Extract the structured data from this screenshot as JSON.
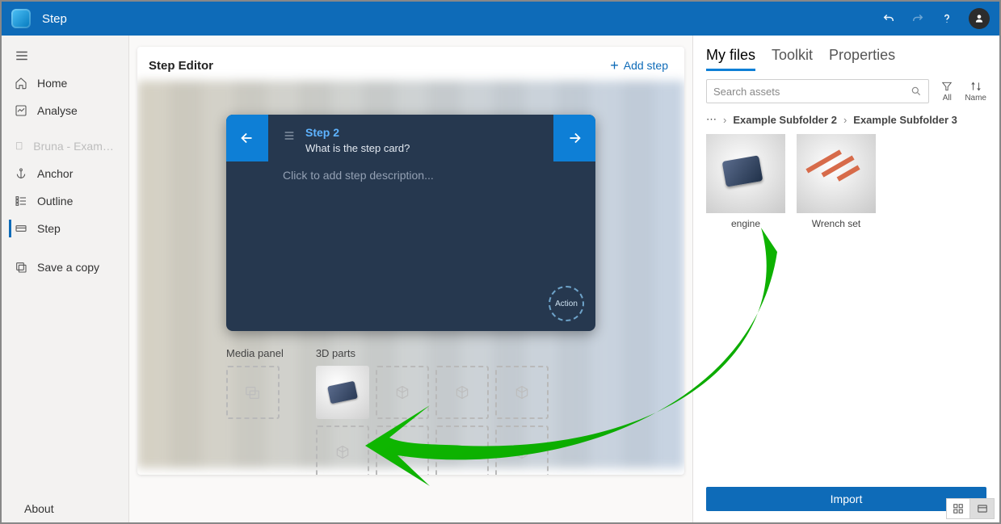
{
  "titlebar": {
    "title": "Step"
  },
  "sidebar": {
    "items": [
      {
        "icon": "home-icon",
        "label": "Home"
      },
      {
        "icon": "analyse-icon",
        "label": "Analyse"
      },
      {
        "icon": "document-icon",
        "label": "Bruna - Example Gui…",
        "dimmed": true
      },
      {
        "icon": "anchor-icon",
        "label": "Anchor"
      },
      {
        "icon": "outline-icon",
        "label": "Outline"
      },
      {
        "icon": "step-icon",
        "label": "Step",
        "active": true
      },
      {
        "icon": "savecopy-icon",
        "label": "Save a copy"
      }
    ],
    "about": "About"
  },
  "editor": {
    "title": "Step Editor",
    "add_step": "Add step",
    "step_card": {
      "title": "Step 2",
      "subtitle": "What is the step card?",
      "placeholder": "Click to add step description...",
      "action_label": "Action"
    },
    "media_panel_label": "Media panel",
    "parts_panel_label": "3D parts"
  },
  "rightpanel": {
    "tabs": [
      "My files",
      "Toolkit",
      "Properties"
    ],
    "active_tab": 0,
    "search_placeholder": "Search assets",
    "filter_all_label": "All",
    "sort_label": "Name",
    "breadcrumb": [
      "Example Subfolder 2",
      "Example Subfolder 3"
    ],
    "assets": [
      {
        "label": "engine",
        "kind": "engine"
      },
      {
        "label": "Wrench set",
        "kind": "wrench"
      }
    ],
    "import_label": "Import"
  }
}
